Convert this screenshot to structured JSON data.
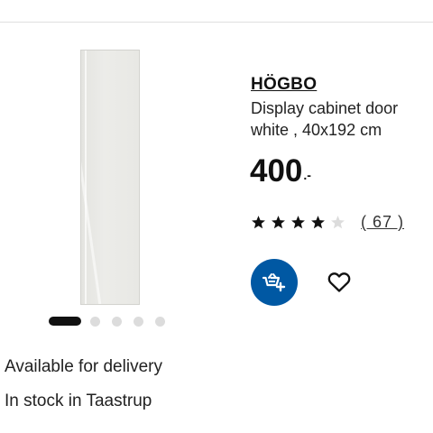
{
  "product": {
    "name": "HÖGBO",
    "description": "Display cabinet door white , 40x192 cm",
    "price": "400",
    "price_suffix": ".-",
    "rating": 4,
    "rating_max": 5,
    "reviews": "( 67 )"
  },
  "gallery": {
    "image_count": 5,
    "active_index": 0
  },
  "availability": {
    "delivery": "Available for delivery",
    "stock": "In stock in Taastrup"
  },
  "icons": {
    "cart": "add-to-cart-icon",
    "favourite": "heart-icon",
    "star": "star-icon"
  },
  "colors": {
    "brand_blue": "#0058a3",
    "text": "#111111",
    "star_filled": "#111111",
    "star_empty": "#dcdcdc"
  }
}
